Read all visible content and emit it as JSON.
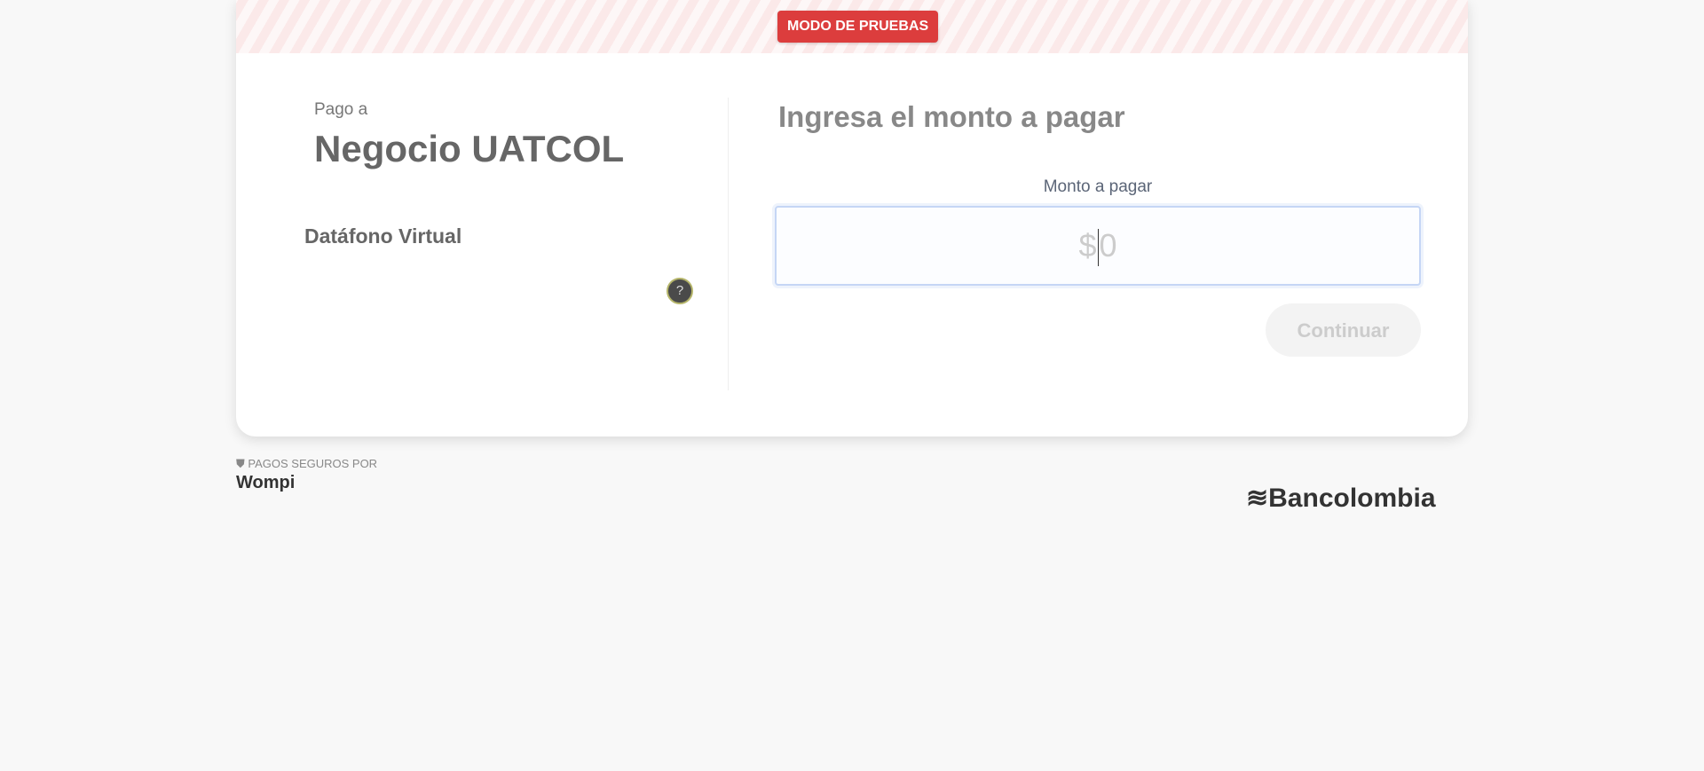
{
  "banner": {
    "badge": "MODO DE PRUEBAS"
  },
  "merchant": {
    "pay_to_label": "Pago a",
    "name": "Negocio UATCOL",
    "product": "Datáfono Virtual",
    "help_icon": "?"
  },
  "form": {
    "title": "Ingresa el monto a pagar",
    "amount_label": "Monto a pagar",
    "currency": "$",
    "amount_value": "0",
    "continue_label": "Continuar"
  },
  "footer": {
    "secure_text": "PAGOS SEGUROS POR",
    "wompi": "Wompi",
    "bank": "Bancolombia"
  }
}
